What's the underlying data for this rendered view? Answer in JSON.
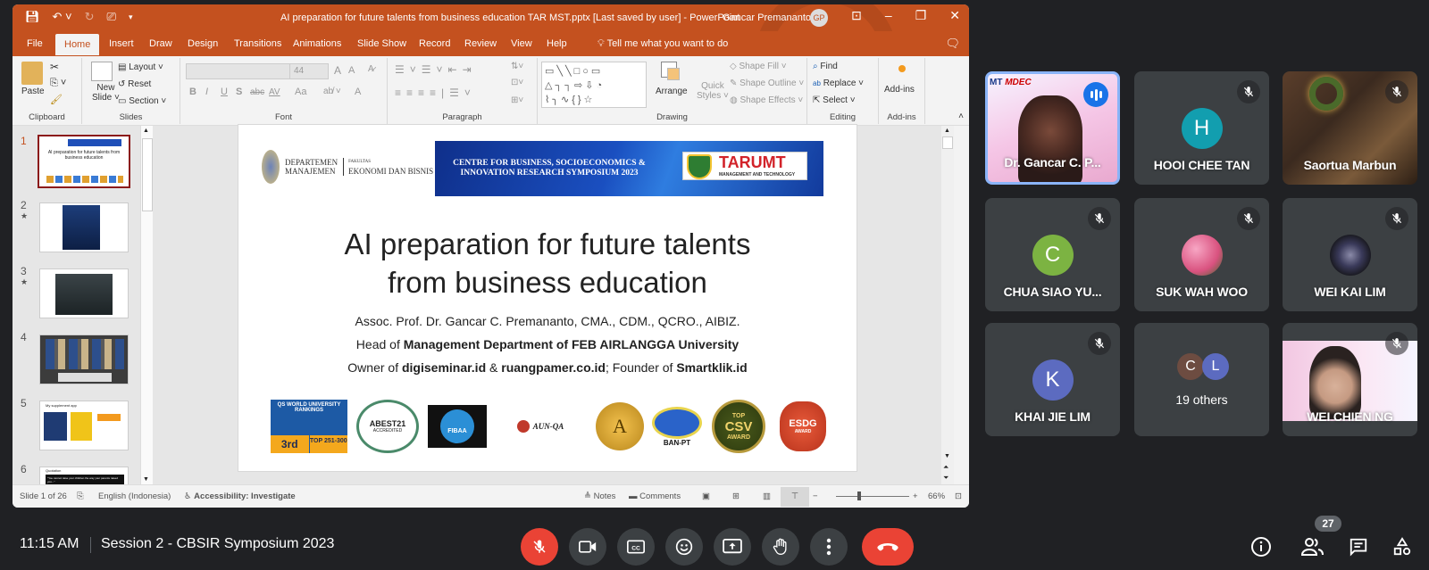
{
  "ppt": {
    "title": "AI preparation for future talents from business education TAR MST.pptx [Last saved by user]  -  PowerPoint",
    "user_name": "Gancar Premananto",
    "user_initials": "GP",
    "tabs": [
      "File",
      "Home",
      "Insert",
      "Draw",
      "Design",
      "Transitions",
      "Animations",
      "Slide Show",
      "Record",
      "Review",
      "View",
      "Help"
    ],
    "active_tab": "Home",
    "tell_me": "Tell me what you want to do",
    "ribbon": {
      "clipboard": {
        "label": "Clipboard",
        "paste": "Paste"
      },
      "slides": {
        "label": "Slides",
        "new_slide_1": "New",
        "new_slide_2": "Slide",
        "layout": "Layout",
        "reset": "Reset",
        "section": "Section"
      },
      "font": {
        "label": "Font",
        "font_size": "44",
        "bold": "B",
        "italic": "I",
        "underline": "U",
        "shadow": "S",
        "strike": "abc",
        "spacing": "AV",
        "case": "Aa",
        "grow": "A",
        "shrink": "A",
        "color": "A"
      },
      "paragraph": {
        "label": "Paragraph"
      },
      "drawing": {
        "label": "Drawing",
        "arrange": "Arrange",
        "quick_styles_1": "Quick",
        "quick_styles_2": "Styles",
        "shape_fill": "Shape Fill",
        "shape_outline": "Shape Outline",
        "shape_effects": "Shape Effects",
        "shapes_row1": "▭╲╲□○▭",
        "shapes_row2": "△┐┐⇨⇩◔",
        "shapes_row3": "⌇╮∿{}☆"
      },
      "editing": {
        "label": "Editing",
        "find": "Find",
        "replace": "Replace",
        "select": "Select"
      },
      "addins": {
        "label": "Add-ins",
        "addins": "Add-ins"
      }
    },
    "thumbnails": [
      {
        "num": "1",
        "active": true
      },
      {
        "num": "2",
        "star": "★"
      },
      {
        "num": "3",
        "star": "★"
      },
      {
        "num": "4"
      },
      {
        "num": "5"
      },
      {
        "num": "6"
      }
    ],
    "thumb_text": {
      "t1_title": "AI preparation for future talents from business education",
      "t5_label": "My supplement app",
      "t6_label": "Quotation",
      "t6_quote": "\"You cannot raise your children the way your parents raised you...\""
    },
    "slide": {
      "dept_line1": "DEPARTEMEN",
      "dept_line2": "MANAJEMEN",
      "fac_small": "FAKULTAS",
      "fac_line": "EKONOMI DAN BISNIS",
      "banner_line1": "CENTRE FOR BUSINESS, SOCIOECONOMICS &",
      "banner_line2": "INNOVATION RESEARCH SYMPOSIUM 2023",
      "taru": "TARUMT",
      "taru_sub": "MANAGEMENT AND TECHNOLOGY",
      "title_line1": "AI preparation for future talents",
      "title_line2": "from business education",
      "author": "Assoc. Prof. Dr. Gancar C. Premananto, CMA., CDM., QCRO., AIBIZ.",
      "head_prefix": "Head of ",
      "head_bold": "Management Department of FEB AIRLANGGA University",
      "owner_prefix": "Owner of ",
      "owner_b1": "digiseminar.id",
      "owner_amp": " & ",
      "owner_b2": "ruangpamer.co.id",
      "owner_mid": "; Founder of ",
      "owner_b3": "Smartklik.id",
      "badges": {
        "qs_top": "QS WORLD UNIVERSITY RANKINGS",
        "qs_rank": "3rd",
        "qs_range": "TOP 251-300",
        "abest": "ABEST21",
        "abest_sub": "ACCREDITED",
        "fibaa": "FIBAA",
        "aunqa": "AUN-QA",
        "a": "A",
        "banpt": "BAN-PT",
        "csv_top": "TOP",
        "csv": "CSV",
        "csv_award": "AWARD",
        "esdg": "ESDG",
        "esdg_award": "AWARD"
      }
    },
    "status": {
      "slide_of": "Slide 1 of 26",
      "language": "English (Indonesia)",
      "accessibility": "Accessibility: Investigate",
      "notes": "Notes",
      "comments": "Comments",
      "zoom": "66%",
      "zoom_level": 0.66
    }
  },
  "meet": {
    "tiles": [
      {
        "name": "Dr. Gancar C. P...",
        "speaking": true
      },
      {
        "name": "HOOI CHEE TAN",
        "initial": "H",
        "color": "#129eaf",
        "muted": true
      },
      {
        "name": "Saortua Marbun",
        "muted": true
      },
      {
        "name": "CHUA SIAO YU...",
        "initial": "C",
        "color": "#7cb342",
        "muted": true
      },
      {
        "name": "SUK WAH WOO",
        "muted": true
      },
      {
        "name": "WEI KAI LIM",
        "muted": true
      },
      {
        "name": "KHAI JIE LIM",
        "initial": "K",
        "color": "#5c6bc0",
        "muted": true
      },
      {
        "others": "19 others",
        "i1": "C",
        "i2": "L",
        "c1": "#6d4c41",
        "c2": "#5c6bc0"
      },
      {
        "name": "WEI CHIEN NG",
        "muted": true
      }
    ],
    "time": "11:15 AM",
    "meeting_name": "Session 2 - CBSIR Symposium 2023",
    "participant_count": "27",
    "colors": {
      "end_call": "#ea4335",
      "control": "#3c4043",
      "speaking": "#1a73e8"
    }
  }
}
